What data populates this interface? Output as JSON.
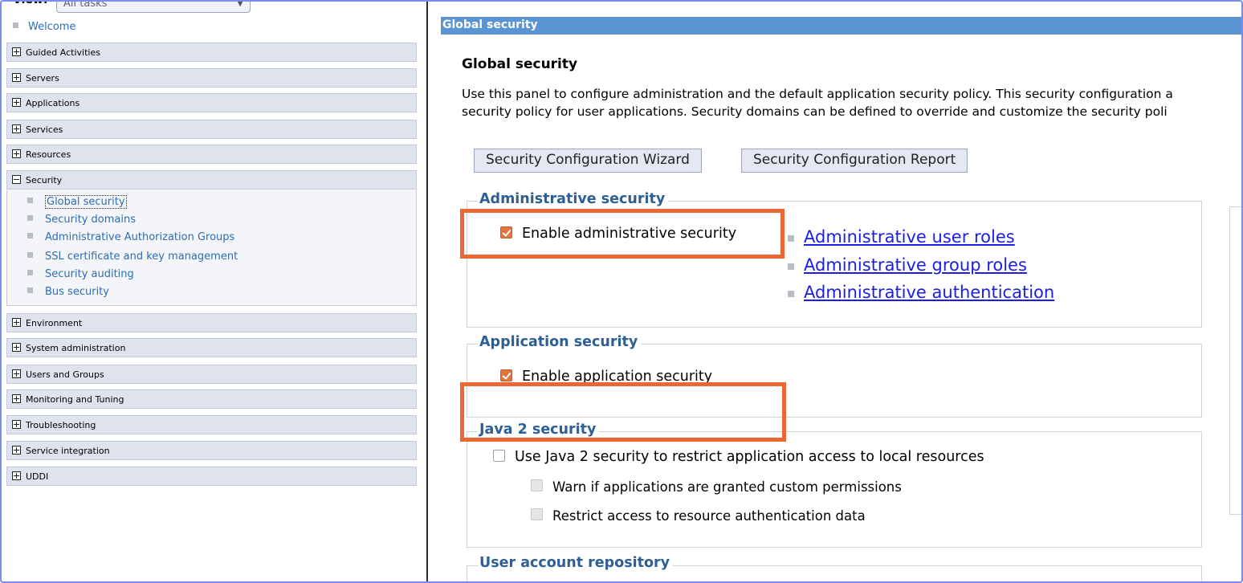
{
  "nav": {
    "view_label": "View:",
    "view_value": "All tasks",
    "welcome": "Welcome",
    "categories_top": [
      {
        "label": "Guided Activities",
        "name": "nav-category-guided-activities"
      },
      {
        "label": "Servers",
        "name": "nav-category-servers"
      },
      {
        "label": "Applications",
        "name": "nav-category-applications"
      },
      {
        "label": "Services",
        "name": "nav-category-services"
      },
      {
        "label": "Resources",
        "name": "nav-category-resources"
      }
    ],
    "security": {
      "label": "Security",
      "items": [
        {
          "label": "Global security",
          "active": true
        },
        {
          "label": "Security domains"
        },
        {
          "label": "Administrative Authorization Groups"
        },
        {
          "label": "SSL certificate and key management"
        },
        {
          "label": "Security auditing"
        },
        {
          "label": "Bus security"
        }
      ]
    },
    "categories_bottom": [
      {
        "label": "Environment"
      },
      {
        "label": "System administration"
      },
      {
        "label": "Users and Groups"
      },
      {
        "label": "Monitoring and Tuning"
      },
      {
        "label": "Troubleshooting"
      },
      {
        "label": "Service integration"
      },
      {
        "label": "UDDI"
      }
    ]
  },
  "content": {
    "title_bar": "Global security",
    "page_title": "Global security",
    "description_line1": "Use this panel to configure administration and the default application security policy. This security configuration a",
    "description_line2": "security policy for user applications. Security domains can be defined to override and customize the security poli",
    "buttons": {
      "wizard": "Security Configuration Wizard",
      "report": "Security Configuration Report"
    },
    "admin_security": {
      "legend": "Administrative security",
      "enable_label": "Enable administrative security",
      "enabled": true,
      "links": [
        "Administrative user roles",
        "Administrative group roles",
        "Administrative authentication"
      ]
    },
    "app_security": {
      "legend": "Application security",
      "enable_label": "Enable application security",
      "enabled": true
    },
    "java2_security": {
      "legend": "Java 2 security",
      "use_label": "Use Java 2 security to restrict application access to local resources",
      "use_checked": false,
      "warn_label": "Warn if applications are granted custom permissions",
      "restrict_label": "Restrict access to resource authentication data"
    },
    "user_repo": {
      "legend": "User account repository"
    }
  },
  "colors": {
    "highlight": "#ec6732",
    "title_bar": "#5b94d2",
    "link": "#1a1ee6",
    "legend": "#2d5f95",
    "nav_link": "#2c6db5"
  }
}
